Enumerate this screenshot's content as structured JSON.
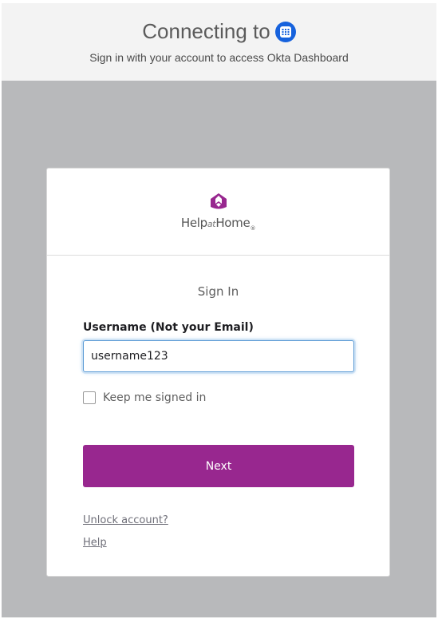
{
  "banner": {
    "title": "Connecting to",
    "icon": "okta-app-icon",
    "subtitle": "Sign in with your account to access Okta Dashboard"
  },
  "logo": {
    "help": "Help",
    "at": "at",
    "home": "Home",
    "reg": "®"
  },
  "form": {
    "title": "Sign In",
    "username_label": "Username (Not your Email)",
    "username_value": "username123",
    "remember_label": "Keep me signed in",
    "remember_checked": false,
    "next_label": "Next"
  },
  "links": {
    "unlock": "Unlock account?",
    "help": "Help"
  },
  "colors": {
    "brand": "#98278f",
    "okta_blue": "#1662dd",
    "background": "#b8b9bb"
  }
}
